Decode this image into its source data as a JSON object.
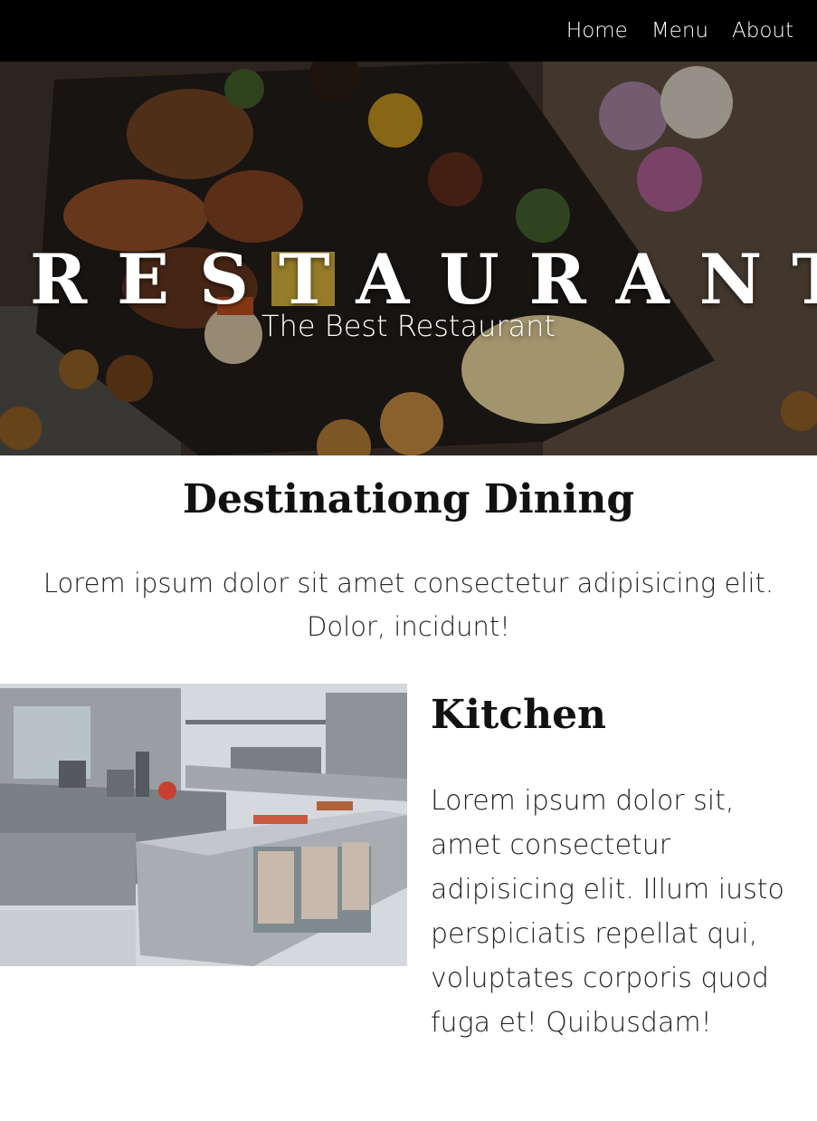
{
  "nav": {
    "links": [
      {
        "label": "Home"
      },
      {
        "label": "Menu"
      },
      {
        "label": "About"
      }
    ]
  },
  "hero": {
    "title": "RESTAURANT",
    "subtitle": "The Best Restaurant"
  },
  "intro": {
    "title": "Destinationg Dining",
    "text": "Lorem ipsum dolor sit amet consectetur adipisicing elit. Dolor, incidunt!"
  },
  "kitchen": {
    "title": "Kitchen",
    "text": "Lorem ipsum dolor sit, amet consectetur adipisicing elit. Illum iusto perspiciatis repellat qui, voluptates corporis quod fuga et! Quibusdam!"
  },
  "colors": {
    "nav_bg": "#000000",
    "nav_text": "#ffffff",
    "page_bg": "#ffffff",
    "heading": "#111111"
  }
}
